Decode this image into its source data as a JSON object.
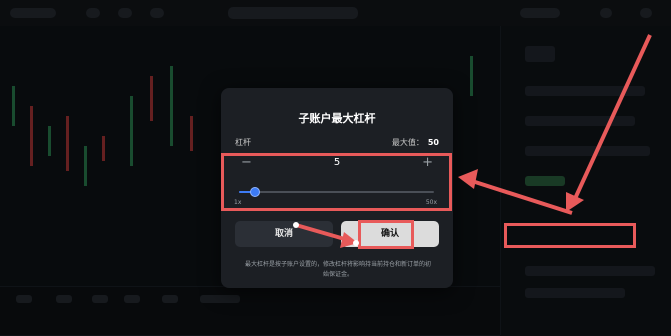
{
  "modal": {
    "title": "子账户最大杠杆",
    "leverage_label": "杠杆",
    "max_label": "最大值：",
    "max_value": "50",
    "current_value": "5",
    "minus": "−",
    "plus": "+",
    "slider_min_label": "1x",
    "slider_max_label": "50x",
    "slider_min": 1,
    "slider_max": 50,
    "slider_value": 5,
    "cancel_label": "取消",
    "confirm_label": "确认",
    "note": "最大杠杆是按子账户设置的，修改杠杆将影响持当前持仓和新订单的初始保证金。"
  },
  "colors": {
    "highlight": "#e85a5a",
    "accent": "#3d7bf5"
  }
}
